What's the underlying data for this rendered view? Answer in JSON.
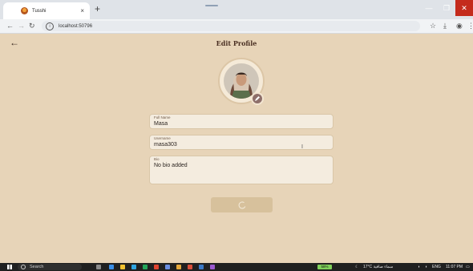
{
  "browser": {
    "tab_title": "Tusshi",
    "tab_close": "×",
    "new_tab": "+",
    "url": "localhost:50796",
    "window_minimize": "—",
    "window_maximize": "❐",
    "window_close": "✕"
  },
  "page": {
    "title": "Edit Profile",
    "back_icon": "arrow-left-icon"
  },
  "profile": {
    "avatar_icon": "profile-photo",
    "edit_icon": "pencil-icon"
  },
  "form": {
    "full_name": {
      "label": "Full Name",
      "value": "Masa"
    },
    "username": {
      "label": "Username",
      "value": "masa303"
    },
    "bio": {
      "label": "Bio",
      "value": "No bio added"
    }
  },
  "save_button": {
    "state": "loading",
    "icon": "spinner-icon"
  },
  "taskbar": {
    "search_placeholder": "Search",
    "battery": "58%",
    "weather": "17°C  سماء صافية",
    "language": "ENG",
    "time": "11:07 PM"
  },
  "colors": {
    "background": "#e7d4b8",
    "field_fill": "#f4ecdf",
    "title_text": "#4a2f22",
    "edit_badge": "#8e6f6a",
    "save_button": "#d7c19c"
  }
}
